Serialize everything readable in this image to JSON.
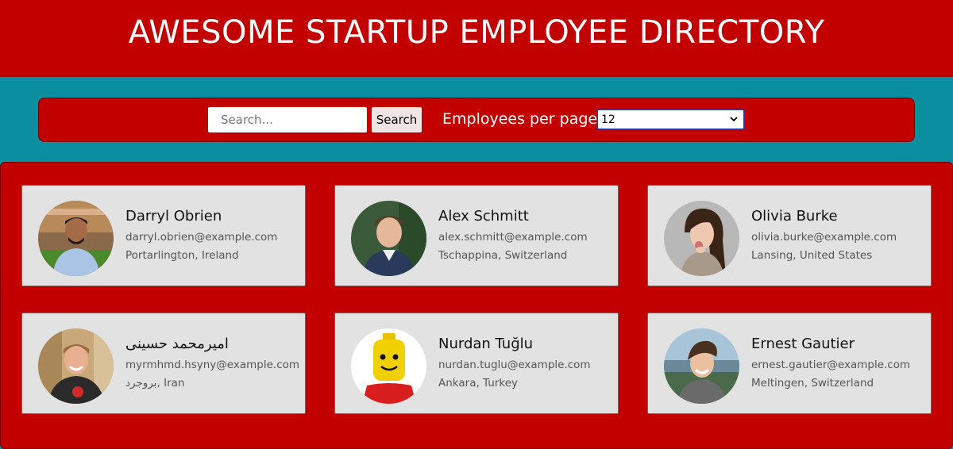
{
  "header": {
    "title": "AWESOME STARTUP EMPLOYEE DIRECTORY"
  },
  "toolbar": {
    "search_placeholder": "Search...",
    "search_button": "Search",
    "per_page_label": "Employees per page",
    "per_page_value": "12"
  },
  "employees": [
    {
      "name": "Darryl Obrien",
      "email": "darryl.obrien@example.com",
      "location": "Portarlington, Ireland",
      "photo": "man-outdoors-photo"
    },
    {
      "name": "Alex Schmitt",
      "email": "alex.schmitt@example.com",
      "location": "Tschappina, Switzerland",
      "photo": "young-man-photo"
    },
    {
      "name": "Olivia Burke",
      "email": "olivia.burke@example.com",
      "location": "Lansing, United States",
      "photo": "surprised-woman-photo"
    },
    {
      "name": "امیرمحمد حسینی",
      "email": "myrmhmd.hsyny@example.com",
      "location": "بروجرد, Iran",
      "photo": "smiling-man-photo"
    },
    {
      "name": "Nurdan Tuğlu",
      "email": "nurdan.tuglu@example.com",
      "location": "Ankara, Turkey",
      "photo": "lego-figure-photo"
    },
    {
      "name": "Ernest Gautier",
      "email": "ernest.gautier@example.com",
      "location": "Meltingen, Switzerland",
      "photo": "laughing-man-photo"
    }
  ],
  "colors": {
    "page_background": "#0a8ea0",
    "header_background": "#c20000",
    "card_background": "#e2e2e2"
  }
}
